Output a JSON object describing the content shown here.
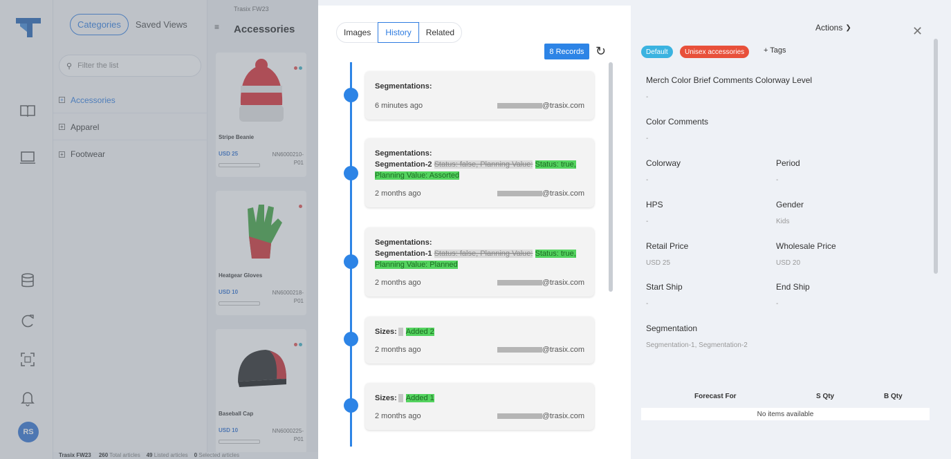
{
  "categories_panel": {
    "tabs": [
      "Categories",
      "Saved Views"
    ],
    "filter_placeholder": "Filter the list",
    "items": [
      "Accessories",
      "Apparel",
      "Footwear"
    ]
  },
  "products_panel": {
    "season": "Trasix FW23",
    "title": "Accessories",
    "products": [
      {
        "name": "Stripe Beanie",
        "price": "USD 25",
        "sku": "NN6000210-",
        "sku2": "P01"
      },
      {
        "name": "Heatgear Gloves",
        "price": "USD 10",
        "sku": "NN6000218-",
        "sku2": "P01"
      },
      {
        "name": "Baseball Cap",
        "price": "USD 10",
        "sku": "NN6000225-",
        "sku2": "P01"
      }
    ]
  },
  "user": {
    "initials": "RS"
  },
  "footer": {
    "season": "Trasix FW23",
    "total_count": "260",
    "total_label": "Total articles",
    "listed_count": "49",
    "listed_label": "Listed articles",
    "selected_count": "0",
    "selected_label": "Selected articles"
  },
  "history": {
    "tabs": [
      "Images",
      "History",
      "Related"
    ],
    "records_label": "8 Records",
    "entries": [
      {
        "title": "Segmentations:",
        "field": "",
        "old": "",
        "new": "",
        "time": "6 minutes ago",
        "user": "@trasix.com"
      },
      {
        "title": "Segmentations:",
        "field": "Segmentation-2",
        "old": "Status: false, Planning Value:",
        "new": "Status: true, Planning Value: Assorted",
        "time": "2 months ago",
        "user": "@trasix.com"
      },
      {
        "title": "Segmentations:",
        "field": "Segmentation-1",
        "old": "Status: false, Planning Value:",
        "new": "Status: true, Planning Value: Planned",
        "time": "2 months ago",
        "user": "@trasix.com"
      },
      {
        "title": "Sizes:",
        "field": "",
        "old": "",
        "new": "Added 2",
        "time": "2 months ago",
        "user": "@trasix.com"
      },
      {
        "title": "Sizes:",
        "field": "",
        "old": "",
        "new": "Added 1",
        "time": "2 months ago",
        "user": "@trasix.com"
      }
    ]
  },
  "details": {
    "actions_label": "Actions",
    "tags": [
      {
        "label": "Default",
        "color": "#3bb3e0"
      },
      {
        "label": "Unisex accessories",
        "color": "#e8503a"
      }
    ],
    "add_tags_label": "+ Tags",
    "fields": {
      "merch_color": {
        "label": "Merch Color Brief Comments Colorway Level",
        "value": "-"
      },
      "color_comments": {
        "label": "Color Comments",
        "value": "-"
      },
      "colorway": {
        "label": "Colorway",
        "value": "-"
      },
      "period": {
        "label": "Period",
        "value": "-"
      },
      "hps": {
        "label": "HPS",
        "value": "-"
      },
      "gender": {
        "label": "Gender",
        "value": "Kids"
      },
      "retail_price": {
        "label": "Retail Price",
        "value": "USD 25"
      },
      "wholesale_price": {
        "label": "Wholesale Price",
        "value": "USD 20"
      },
      "start_ship": {
        "label": "Start Ship",
        "value": "-"
      },
      "end_ship": {
        "label": "End Ship",
        "value": "-"
      },
      "segmentation": {
        "label": "Segmentation",
        "value": "Segmentation-1, Segmentation-2"
      }
    },
    "forecast": {
      "headers": [
        "Forecast For",
        "S Qty",
        "B Qty"
      ],
      "empty_text": "No items available"
    }
  },
  "colors": {
    "accent": "#2d84e6",
    "diff_added": "#54d35f",
    "diff_removed": "#d9d9d9"
  }
}
